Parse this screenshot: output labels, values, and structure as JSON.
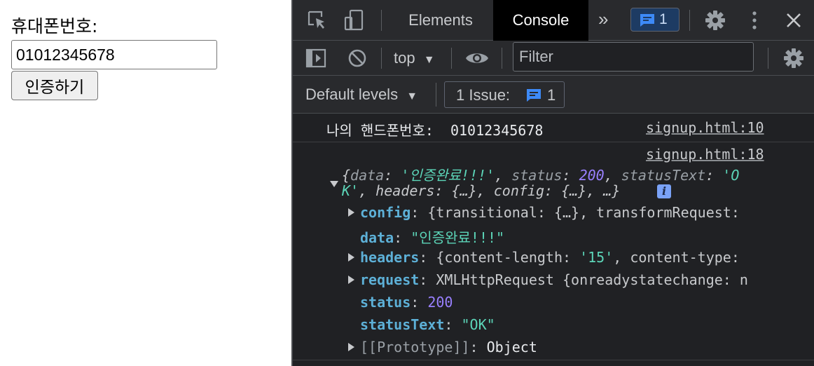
{
  "page": {
    "phone_label": "휴대폰번호:",
    "phone_value": "01012345678",
    "verify_button": "인증하기"
  },
  "devtools": {
    "tabs": [
      "Elements",
      "Console"
    ],
    "active_tab": "Console",
    "more_tabs_glyph": "»",
    "issues_badge_count": "1",
    "context": "top",
    "filter_placeholder": "Filter",
    "levels": "Default levels",
    "issue_button_label": "1 Issue:",
    "issue_button_count": "1",
    "icons": [
      "inspect-icon",
      "device-toggle-icon",
      "message-icon",
      "gear-icon",
      "kebab-menu-icon",
      "close-icon",
      "sidebar-icon",
      "clear-icon",
      "eye-icon",
      "chevron-down-icon",
      "info-icon"
    ]
  },
  "console": {
    "log1": {
      "text": "나의 핸드폰번호:  01012345678",
      "source": "signup.html:10"
    },
    "log2": {
      "source": "signup.html:18",
      "summary": {
        "open": "{",
        "data_key": "data",
        "data_val": "'인증완료!!!'",
        "status_key": "status",
        "status_val": "200",
        "statusText_key": "statusText",
        "statusText_val_a": "'O",
        "statusText_val_b": "K'",
        "rest": ", headers: {…}, config: {…}, …}"
      },
      "props": [
        {
          "key": "config",
          "value": "{transitional: {…}, transformRequest:",
          "expandable": true
        },
        {
          "key": "data",
          "value": "\"인증완료!!!\"",
          "expandable": false,
          "type": "string"
        },
        {
          "key": "headers",
          "value_a": "{content-length: ",
          "value_b": "'15'",
          "value_c": ", content-type:",
          "expandable": true
        },
        {
          "key": "request",
          "value": "XMLHttpRequest {onreadystatechange: n",
          "expandable": true
        },
        {
          "key": "status",
          "value": "200",
          "expandable": false,
          "type": "number"
        },
        {
          "key": "statusText",
          "value": "\"OK\"",
          "expandable": false,
          "type": "string"
        },
        {
          "key": "[[Prototype]]",
          "value": "Object",
          "expandable": true
        }
      ]
    }
  },
  "colors": {
    "devtools_bg": "#202124",
    "toolbar_bg": "#292a2d",
    "key": "#5db0d7",
    "string": "#5cd5b8",
    "number": "#9980ff"
  }
}
